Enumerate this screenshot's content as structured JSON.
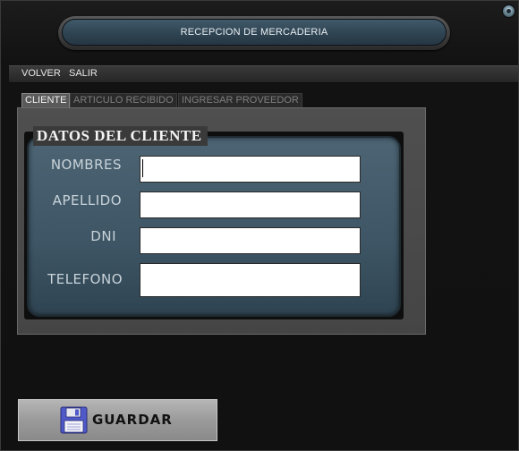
{
  "window": {
    "title": "RECEPCION DE MERCADERIA",
    "close_icon": "close-icon"
  },
  "menu": {
    "items": [
      {
        "label": "VOLVER"
      },
      {
        "label": "SALIR"
      }
    ]
  },
  "tabs": [
    {
      "label": "CLIENTE",
      "active": true
    },
    {
      "label": "ARTICULO RECIBIDO",
      "active": false
    },
    {
      "label": "INGRESAR PROVEEDOR",
      "active": false
    }
  ],
  "group": {
    "title": "DATOS DEL CLIENTE",
    "fields": [
      {
        "label": "NOMBRES",
        "value": "",
        "focused": true
      },
      {
        "label": "APELLIDO",
        "value": ""
      },
      {
        "label": "DNI",
        "value": ""
      },
      {
        "label": "TELEFONO",
        "value": ""
      }
    ]
  },
  "actions": {
    "save_label": "GUARDAR",
    "save_icon": "floppy-disk-icon"
  },
  "colors": {
    "accent_panel": "#3d5564",
    "title_bar": "#2f4452",
    "background": "#151515"
  }
}
